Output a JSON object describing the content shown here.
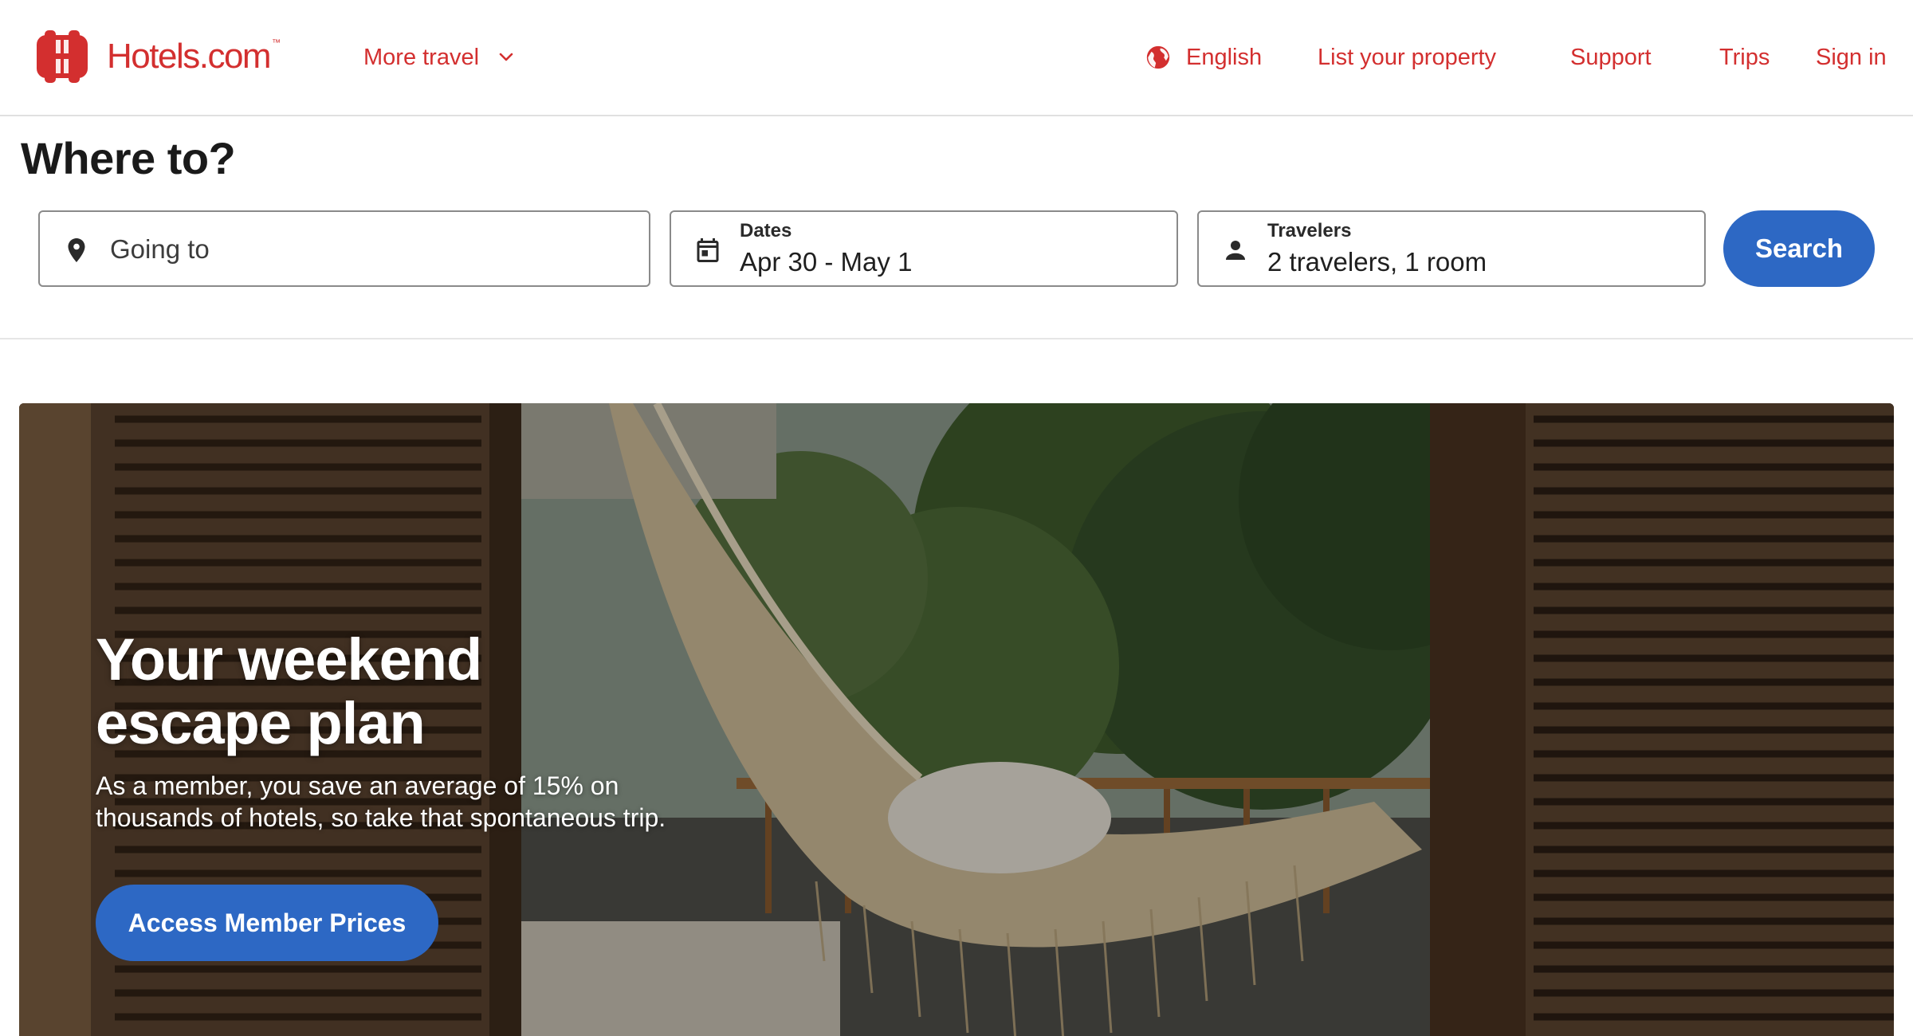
{
  "brand": {
    "name": "Hotels.com",
    "trademark": "™",
    "color": "#d32f2f"
  },
  "header": {
    "more_travel": "More travel",
    "language": "English",
    "list_property": "List your property",
    "support": "Support",
    "trips": "Trips",
    "sign_in": "Sign in"
  },
  "search": {
    "title": "Where to?",
    "destination": {
      "placeholder": "Going to",
      "icon": "map-pin-icon"
    },
    "dates": {
      "label": "Dates",
      "value": "Apr 30 - May 1",
      "icon": "calendar-icon"
    },
    "travelers": {
      "label": "Travelers",
      "value": "2 travelers, 1 room",
      "icon": "person-icon"
    },
    "button": "Search"
  },
  "hero": {
    "title": "Your weekend escape plan",
    "text": "As a member, you save an average of 15% on thousands of hotels, so take that spontaneous trip.",
    "button": "Access Member Prices",
    "image": "hammock-on-balcony-photo"
  },
  "colors": {
    "accent": "#d32f2f",
    "primary_button": "#2d68c4"
  }
}
